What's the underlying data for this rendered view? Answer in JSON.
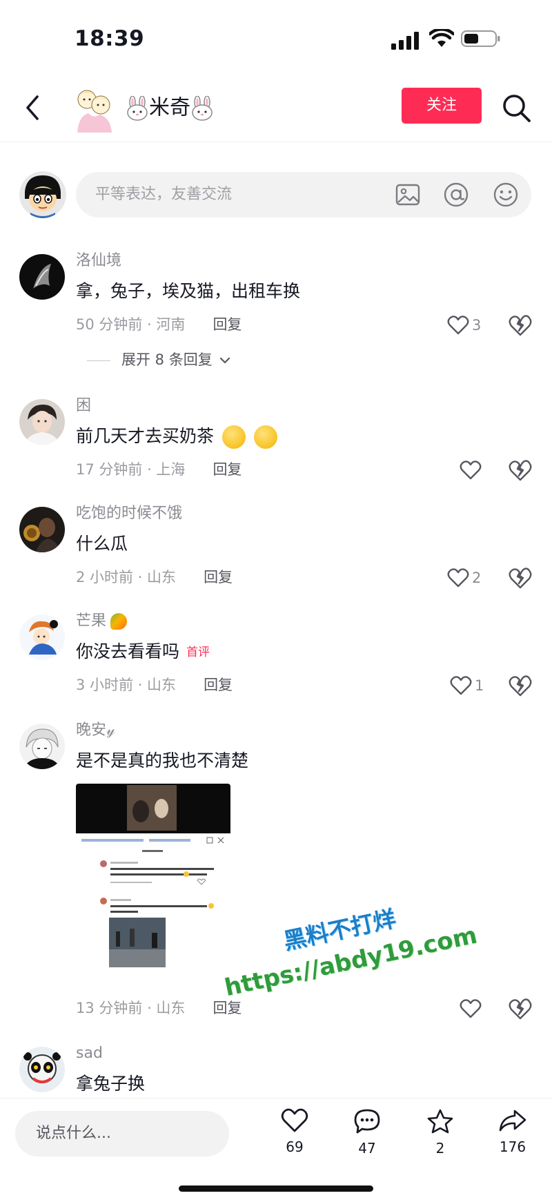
{
  "status_bar": {
    "time": "18:39"
  },
  "header": {
    "author_name": "米奇",
    "follow_label": "关注"
  },
  "compose": {
    "placeholder": "平等表达，友善交流"
  },
  "comments": [
    {
      "user": "洛仙境",
      "text": "拿，兔子，埃及猫，出租车换",
      "time_location": "50 分钟前 · 河南",
      "reply_label": "回复",
      "likes": "3",
      "expand_label": "展开 8 条回复"
    },
    {
      "user": "困",
      "text": "前几天才去买奶茶",
      "time_location": "17 分钟前 · 上海",
      "reply_label": "回复",
      "likes": ""
    },
    {
      "user": "吃饱的时候不饿",
      "text": "什么瓜",
      "time_location": "2 小时前 · 山东",
      "reply_label": "回复",
      "likes": "2"
    },
    {
      "user": "芒果",
      "text": "你没去看看吗",
      "badge": "首评",
      "time_location": "3 小时前 · 山东",
      "reply_label": "回复",
      "likes": "1"
    },
    {
      "user": "晚安𝓎",
      "text": "是不是真的我也不清楚",
      "time_location": "13 分钟前 · 山东",
      "reply_label": "回复",
      "likes": ""
    },
    {
      "user": "sad",
      "text": "拿兔子换"
    }
  ],
  "watermark": {
    "line1": "黑料不打烊",
    "line2": "https://abdy19.com"
  },
  "bottom_bar": {
    "input_placeholder": "说点什么...",
    "likes": "69",
    "comments": "47",
    "favorites": "2",
    "shares": "176"
  },
  "colors": {
    "accent": "#fe2c55",
    "text_primary": "#161823",
    "text_secondary": "#8a8b91"
  }
}
